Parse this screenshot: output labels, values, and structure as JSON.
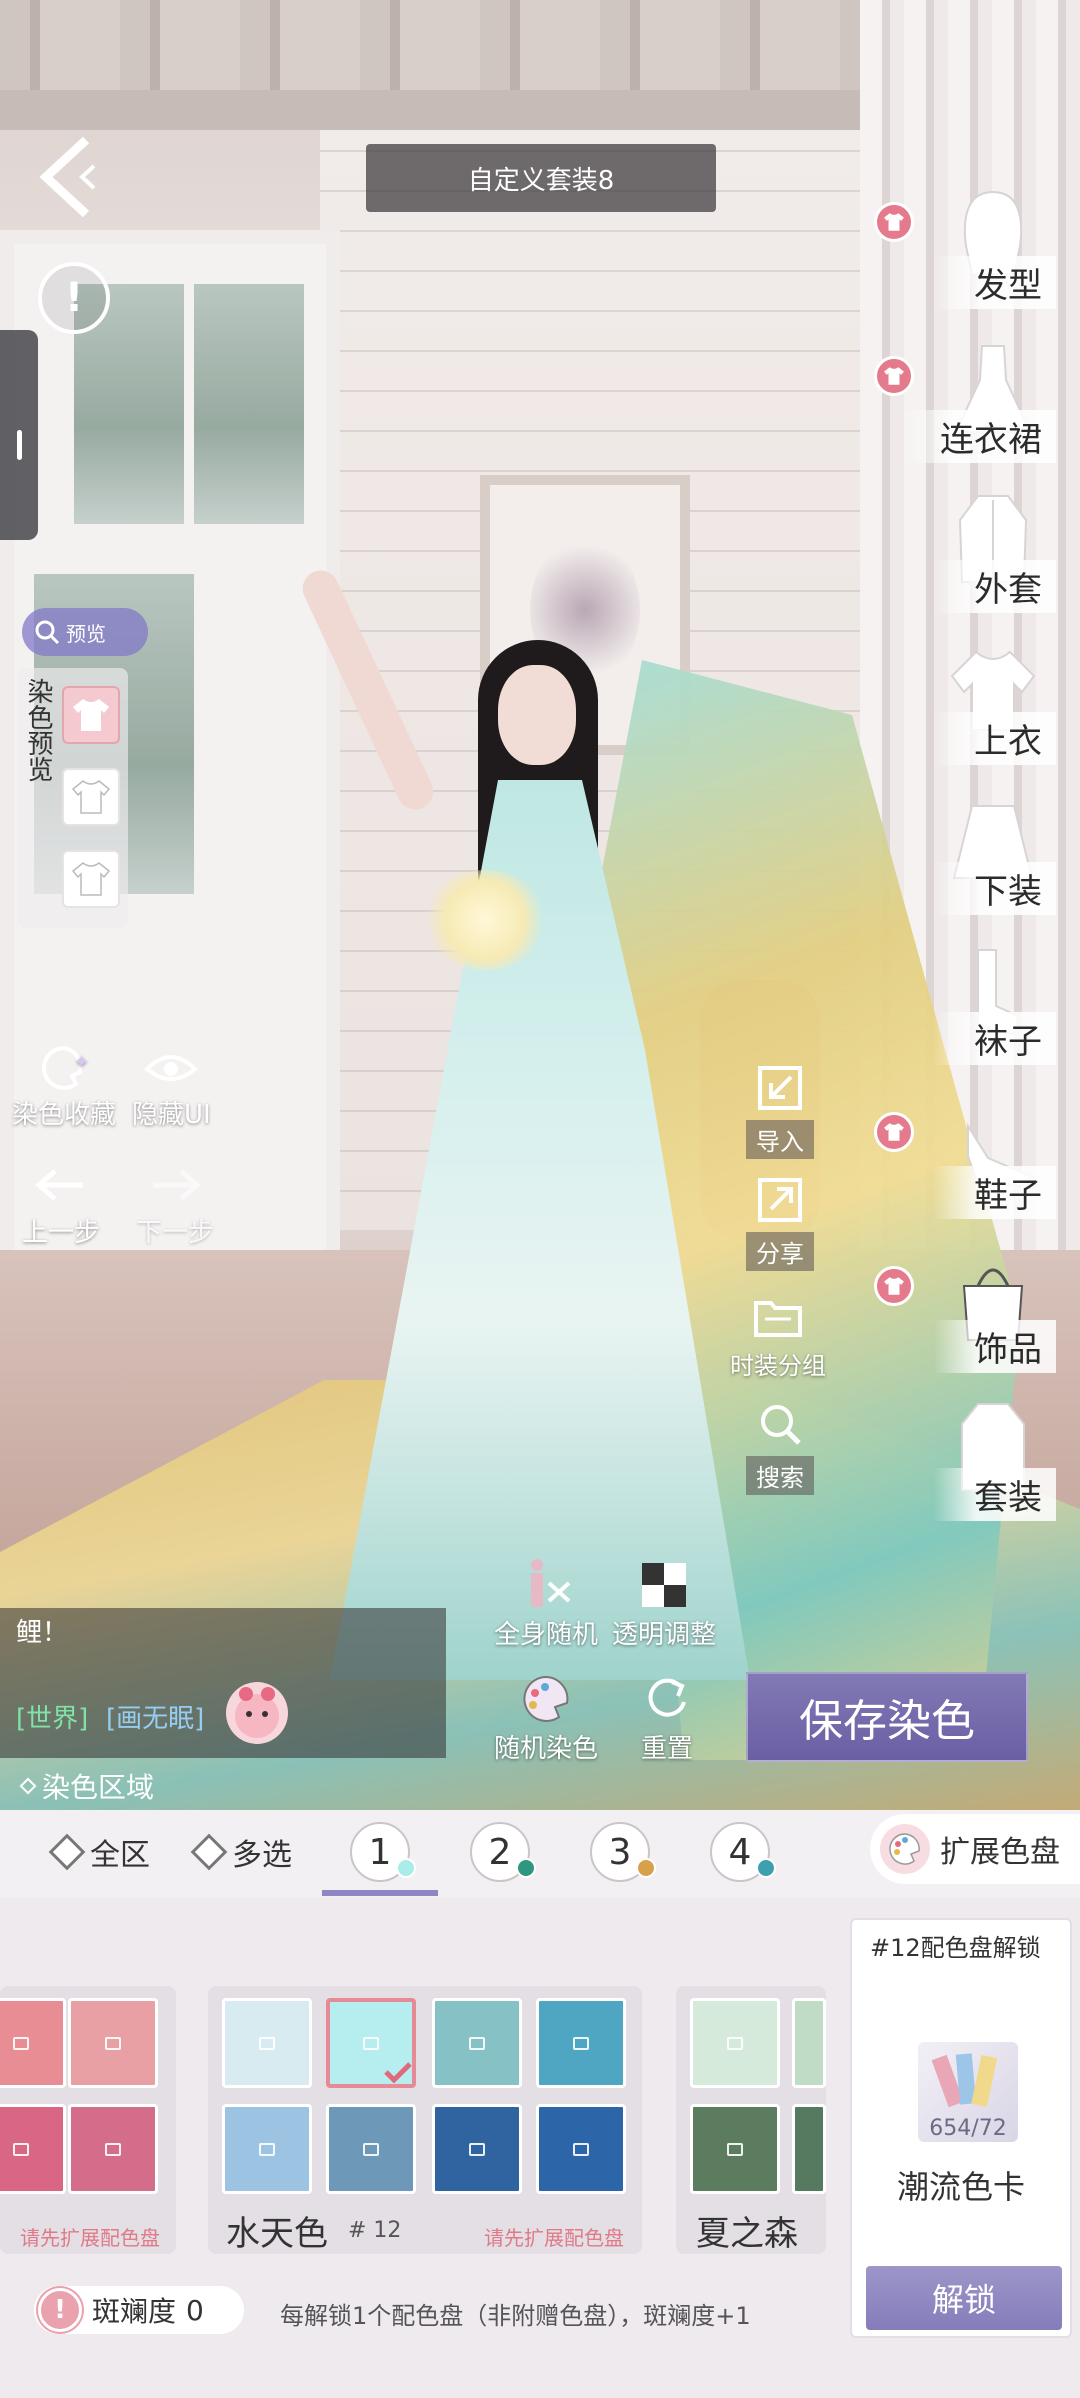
{
  "header": {
    "title": "自定义套装8"
  },
  "left_panel": {
    "preview_pill": "预览",
    "dye_preview_label": "染色预览",
    "tools": [
      {
        "label": "染色收藏",
        "icon": "palette-star-icon"
      },
      {
        "label": "隐藏UI",
        "icon": "eye-icon"
      },
      {
        "label": "上一步",
        "icon": "undo-icon"
      },
      {
        "label": "下一步",
        "icon": "redo-icon"
      }
    ]
  },
  "mid_actions": [
    {
      "label": "导入",
      "icon": "import-icon"
    },
    {
      "label": "分享",
      "icon": "share-icon"
    },
    {
      "label": "时装分组",
      "icon": "folder-icon"
    },
    {
      "label": "搜索",
      "icon": "search-icon"
    }
  ],
  "categories": [
    {
      "label": "发型",
      "badge": true
    },
    {
      "label": "连衣裙",
      "badge": true
    },
    {
      "label": "外套",
      "badge": false
    },
    {
      "label": "上衣",
      "badge": false
    },
    {
      "label": "下装",
      "badge": false
    },
    {
      "label": "袜子",
      "badge": false
    },
    {
      "label": "鞋子",
      "badge": true
    },
    {
      "label": "饰品",
      "badge": true
    },
    {
      "label": "套装",
      "badge": false
    }
  ],
  "chat": {
    "line1": "鲤！",
    "channel": "[世界]",
    "sender": "[画无眠]"
  },
  "center_actions": [
    {
      "label": "全身随机",
      "icon": "body-random-icon"
    },
    {
      "label": "透明调整",
      "icon": "transparency-icon"
    },
    {
      "label": "随机染色",
      "icon": "random-dye-icon"
    },
    {
      "label": "重置",
      "icon": "reset-icon"
    }
  ],
  "save_button": "保存染色",
  "dye_region_label": "染色区域",
  "tabs": {
    "all": "全区",
    "multi": "多选",
    "numbers": [
      {
        "num": "1",
        "dot": "#a9ece9"
      },
      {
        "num": "2",
        "dot": "#2f9680"
      },
      {
        "num": "3",
        "dot": "#d6a14a"
      },
      {
        "num": "4",
        "dot": "#3e9fae"
      }
    ],
    "extend_palette": "扩展色盘"
  },
  "palettes": {
    "left_group": {
      "colors": [
        "#e98d95",
        "#d96682",
        "#e9a0a4",
        "#d46d8a"
      ],
      "hint": "请先扩展配色盘"
    },
    "main_group": {
      "name": "水天色",
      "num": "# 12",
      "hint": "请先扩展配色盘",
      "colors": [
        "#d7ebf1",
        "#b6eef0",
        "#86c1c6",
        "#4fa6c3",
        "#9cc4e2",
        "#6e98b7",
        "#2f64a0",
        "#2c66a9"
      ],
      "selected_index": 1
    },
    "right_group": {
      "name": "夏之森",
      "colors": [
        "#d6eadb",
        "#c0dcc6",
        "#5c7c60",
        "#557a5f"
      ]
    }
  },
  "unlock": {
    "title": "#12配色盘解锁",
    "count": "654/72",
    "card_name": "潮流色卡",
    "button": "解锁"
  },
  "rarity": {
    "label": "斑斓度",
    "value": "0",
    "hint": "每解锁1个配色盘（非附赠色盘），斑斓度+1"
  }
}
